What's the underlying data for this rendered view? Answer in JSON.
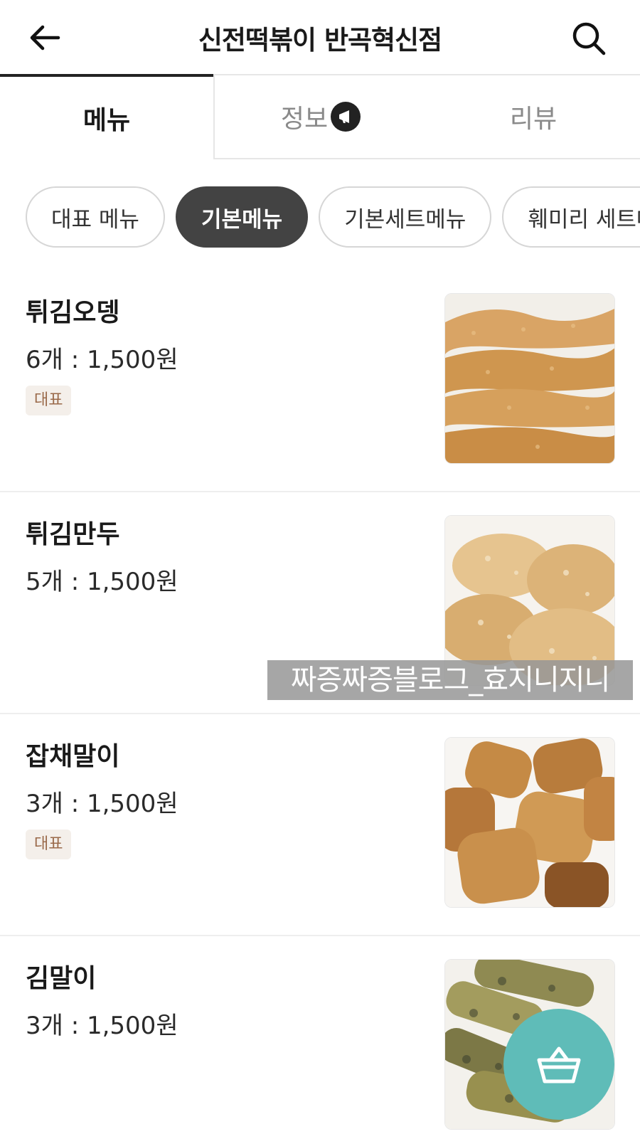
{
  "header": {
    "title": "신전떡볶이 반곡혁신점",
    "back_icon": "arrow-left-icon",
    "search_icon": "search-icon"
  },
  "tabs": [
    {
      "label": "메뉴",
      "active": true
    },
    {
      "label": "정보",
      "active": false,
      "badge_icon": "megaphone-icon"
    },
    {
      "label": "리뷰",
      "active": false
    }
  ],
  "categories": [
    {
      "label": "대표 메뉴",
      "active": false
    },
    {
      "label": "기본메뉴",
      "active": true
    },
    {
      "label": "기본세트메뉴",
      "active": false
    },
    {
      "label": "훼미리 세트메",
      "active": false
    }
  ],
  "menu_items": [
    {
      "name": "튀김오뎅",
      "price": "6개 : 1,500원",
      "badge": "대표",
      "image": "fried-fishcake-photo"
    },
    {
      "name": "튀김만두",
      "price": "5개 : 1,500원",
      "badge": "",
      "image": "fried-dumpling-photo"
    },
    {
      "name": "잡채말이",
      "price": "3개 : 1,500원",
      "badge": "대표",
      "image": "japchae-roll-photo"
    },
    {
      "name": "김말이",
      "price": "3개 : 1,500원",
      "badge": "",
      "image": "seaweed-roll-photo"
    }
  ],
  "watermark": "짜증짜증블로그_효지니지니",
  "cart_button": {
    "icon": "basket-icon",
    "color": "#5fbcb8"
  },
  "colors": {
    "active_chip": "#434343",
    "badge_text": "#9a6a4a",
    "badge_bg": "#f4efea"
  }
}
